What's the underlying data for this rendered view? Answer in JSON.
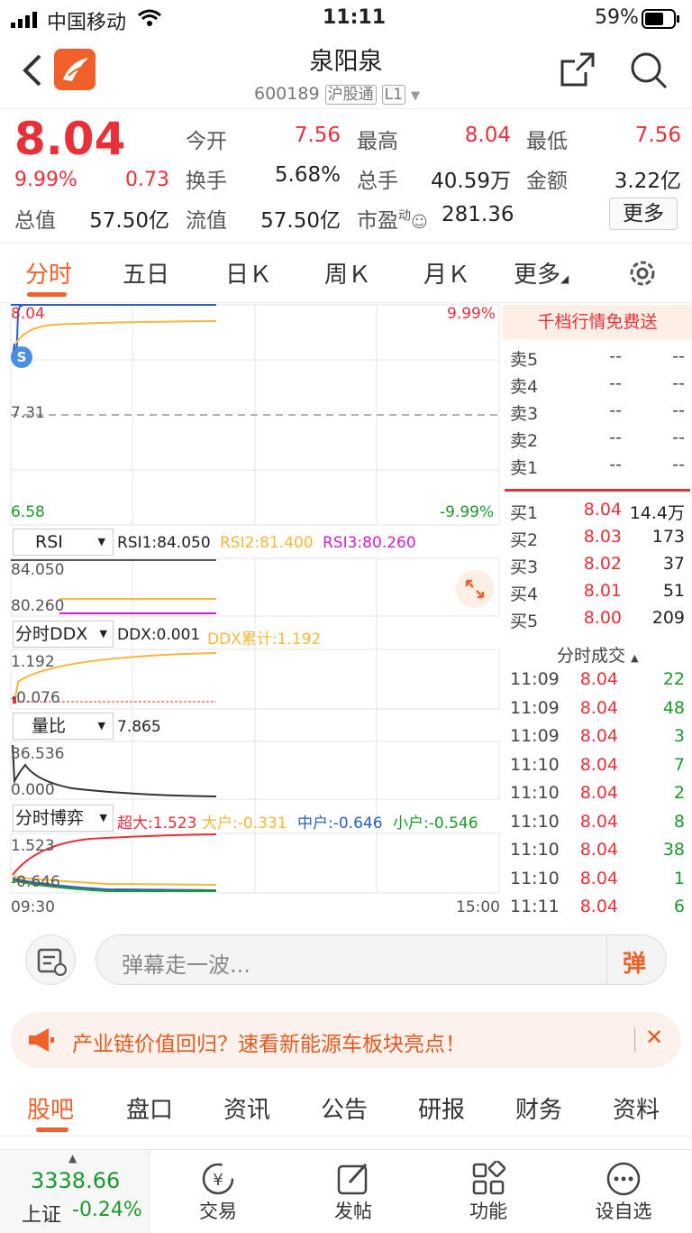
{
  "status": {
    "carrier": "中国移动",
    "time": "11:11",
    "battery": "59%"
  },
  "header": {
    "name": "泉阳泉",
    "code": "600189",
    "tag1": "沪股通",
    "tag2": "L1"
  },
  "quote": {
    "price": "8.04",
    "pct": "9.99%",
    "chg": "0.73",
    "open_l": "今开",
    "open": "7.56",
    "high_l": "最高",
    "high": "8.04",
    "low_l": "最低",
    "low": "7.56",
    "turn_l": "换手",
    "turn": "5.68%",
    "vol_l": "总手",
    "vol": "40.59万",
    "amt_l": "金额",
    "amt": "3.22亿",
    "mcap_l": "总值",
    "mcap": "57.50亿",
    "fcap_l": "流值",
    "fcap": "57.50亿",
    "pe_l": "市盈",
    "pe_sup": "动",
    "pe": "281.36",
    "more": "更多"
  },
  "tabs": [
    "分时",
    "五日",
    "日Ｋ",
    "周Ｋ",
    "月Ｋ",
    "更多"
  ],
  "chart": {
    "main": {
      "top": "8.04",
      "mid": "7.31",
      "bot": "6.58",
      "pct_top": "9.99%",
      "pct_bot": "-9.99%",
      "marker": "S"
    },
    "rsi": {
      "sel": "RSI",
      "v1": "RSI1:84.050",
      "v2": "RSI2:81.400",
      "v3": "RSI3:80.260",
      "hi": "84.050",
      "lo": "80.260"
    },
    "ddx": {
      "sel": "分时DDX",
      "v1": "DDX:0.001",
      "v2": "DDX累计:1.192",
      "hi": "1.192",
      "lo": "-0.076"
    },
    "lb": {
      "sel": "量比",
      "v1": "7.865",
      "hi": "36.536",
      "lo": "0.000"
    },
    "by": {
      "sel": "分时博弈",
      "v1": "超大:1.523",
      "v2": "大户:-0.331",
      "v3": "中户:-0.646",
      "v4": "小户:-0.546",
      "hi": "1.523",
      "lo": "-0.646"
    },
    "time_start": "09:30",
    "time_end": "15:00"
  },
  "colors": {
    "up": "#e8303a",
    "down": "#1a9a2a",
    "accent": "#f0602a",
    "ma": "#f5b73c",
    "magenta": "#d020d0",
    "blue": "#2a60c8"
  },
  "book": {
    "promo": "千档行情免费送",
    "sells": [
      {
        "l": "卖5",
        "p": "--",
        "v": "--"
      },
      {
        "l": "卖4",
        "p": "--",
        "v": "--"
      },
      {
        "l": "卖3",
        "p": "--",
        "v": "--"
      },
      {
        "l": "卖2",
        "p": "--",
        "v": "--"
      },
      {
        "l": "卖1",
        "p": "--",
        "v": "--"
      }
    ],
    "buys": [
      {
        "l": "买1",
        "p": "8.04",
        "v": "14.4万"
      },
      {
        "l": "买2",
        "p": "8.03",
        "v": "173"
      },
      {
        "l": "买3",
        "p": "8.02",
        "v": "37"
      },
      {
        "l": "买4",
        "p": "8.01",
        "v": "51"
      },
      {
        "l": "买5",
        "p": "8.00",
        "v": "209"
      }
    ],
    "ticks_title": "分时成交",
    "ticks": [
      {
        "t": "11:09",
        "p": "8.04",
        "v": "22"
      },
      {
        "t": "11:09",
        "p": "8.04",
        "v": "48"
      },
      {
        "t": "11:09",
        "p": "8.04",
        "v": "3"
      },
      {
        "t": "11:10",
        "p": "8.04",
        "v": "7"
      },
      {
        "t": "11:10",
        "p": "8.04",
        "v": "2"
      },
      {
        "t": "11:10",
        "p": "8.04",
        "v": "8"
      },
      {
        "t": "11:10",
        "p": "8.04",
        "v": "38"
      },
      {
        "t": "11:10",
        "p": "8.04",
        "v": "1"
      },
      {
        "t": "11:11",
        "p": "8.04",
        "v": "6"
      }
    ]
  },
  "danmaku": {
    "placeholder": "弹幕走一波...",
    "btn": "弹"
  },
  "ad": {
    "text": "产业链价值回归？速看新能源车板块亮点！"
  },
  "btabs": [
    "股吧",
    "盘口",
    "资讯",
    "公告",
    "研报",
    "财务",
    "资料"
  ],
  "nav": {
    "index_val": "3338.66",
    "index_name": "上证",
    "index_pct": "-0.24%",
    "items": [
      "交易",
      "发帖",
      "功能",
      "设自选"
    ]
  }
}
